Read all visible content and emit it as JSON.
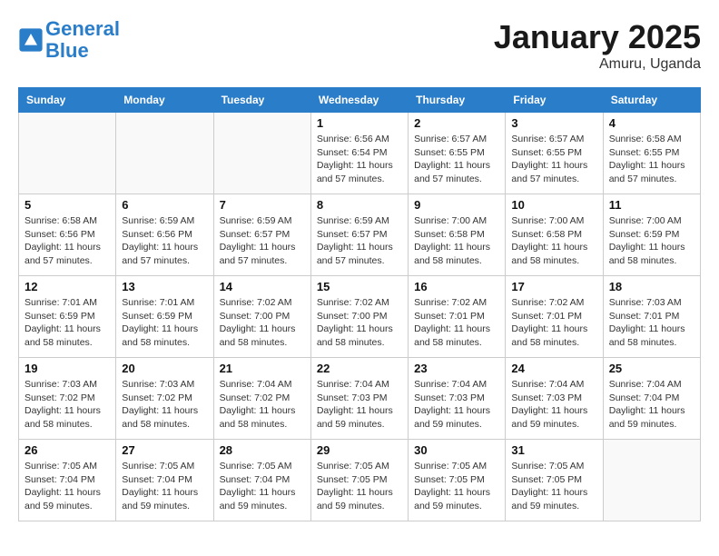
{
  "header": {
    "logo_line1": "General",
    "logo_line2": "Blue",
    "month": "January 2025",
    "location": "Amuru, Uganda"
  },
  "days_of_week": [
    "Sunday",
    "Monday",
    "Tuesday",
    "Wednesday",
    "Thursday",
    "Friday",
    "Saturday"
  ],
  "weeks": [
    [
      {
        "day": "",
        "info": ""
      },
      {
        "day": "",
        "info": ""
      },
      {
        "day": "",
        "info": ""
      },
      {
        "day": "1",
        "info": "Sunrise: 6:56 AM\nSunset: 6:54 PM\nDaylight: 11 hours and 57 minutes."
      },
      {
        "day": "2",
        "info": "Sunrise: 6:57 AM\nSunset: 6:55 PM\nDaylight: 11 hours and 57 minutes."
      },
      {
        "day": "3",
        "info": "Sunrise: 6:57 AM\nSunset: 6:55 PM\nDaylight: 11 hours and 57 minutes."
      },
      {
        "day": "4",
        "info": "Sunrise: 6:58 AM\nSunset: 6:55 PM\nDaylight: 11 hours and 57 minutes."
      }
    ],
    [
      {
        "day": "5",
        "info": "Sunrise: 6:58 AM\nSunset: 6:56 PM\nDaylight: 11 hours and 57 minutes."
      },
      {
        "day": "6",
        "info": "Sunrise: 6:59 AM\nSunset: 6:56 PM\nDaylight: 11 hours and 57 minutes."
      },
      {
        "day": "7",
        "info": "Sunrise: 6:59 AM\nSunset: 6:57 PM\nDaylight: 11 hours and 57 minutes."
      },
      {
        "day": "8",
        "info": "Sunrise: 6:59 AM\nSunset: 6:57 PM\nDaylight: 11 hours and 57 minutes."
      },
      {
        "day": "9",
        "info": "Sunrise: 7:00 AM\nSunset: 6:58 PM\nDaylight: 11 hours and 58 minutes."
      },
      {
        "day": "10",
        "info": "Sunrise: 7:00 AM\nSunset: 6:58 PM\nDaylight: 11 hours and 58 minutes."
      },
      {
        "day": "11",
        "info": "Sunrise: 7:00 AM\nSunset: 6:59 PM\nDaylight: 11 hours and 58 minutes."
      }
    ],
    [
      {
        "day": "12",
        "info": "Sunrise: 7:01 AM\nSunset: 6:59 PM\nDaylight: 11 hours and 58 minutes."
      },
      {
        "day": "13",
        "info": "Sunrise: 7:01 AM\nSunset: 6:59 PM\nDaylight: 11 hours and 58 minutes."
      },
      {
        "day": "14",
        "info": "Sunrise: 7:02 AM\nSunset: 7:00 PM\nDaylight: 11 hours and 58 minutes."
      },
      {
        "day": "15",
        "info": "Sunrise: 7:02 AM\nSunset: 7:00 PM\nDaylight: 11 hours and 58 minutes."
      },
      {
        "day": "16",
        "info": "Sunrise: 7:02 AM\nSunset: 7:01 PM\nDaylight: 11 hours and 58 minutes."
      },
      {
        "day": "17",
        "info": "Sunrise: 7:02 AM\nSunset: 7:01 PM\nDaylight: 11 hours and 58 minutes."
      },
      {
        "day": "18",
        "info": "Sunrise: 7:03 AM\nSunset: 7:01 PM\nDaylight: 11 hours and 58 minutes."
      }
    ],
    [
      {
        "day": "19",
        "info": "Sunrise: 7:03 AM\nSunset: 7:02 PM\nDaylight: 11 hours and 58 minutes."
      },
      {
        "day": "20",
        "info": "Sunrise: 7:03 AM\nSunset: 7:02 PM\nDaylight: 11 hours and 58 minutes."
      },
      {
        "day": "21",
        "info": "Sunrise: 7:04 AM\nSunset: 7:02 PM\nDaylight: 11 hours and 58 minutes."
      },
      {
        "day": "22",
        "info": "Sunrise: 7:04 AM\nSunset: 7:03 PM\nDaylight: 11 hours and 59 minutes."
      },
      {
        "day": "23",
        "info": "Sunrise: 7:04 AM\nSunset: 7:03 PM\nDaylight: 11 hours and 59 minutes."
      },
      {
        "day": "24",
        "info": "Sunrise: 7:04 AM\nSunset: 7:03 PM\nDaylight: 11 hours and 59 minutes."
      },
      {
        "day": "25",
        "info": "Sunrise: 7:04 AM\nSunset: 7:04 PM\nDaylight: 11 hours and 59 minutes."
      }
    ],
    [
      {
        "day": "26",
        "info": "Sunrise: 7:05 AM\nSunset: 7:04 PM\nDaylight: 11 hours and 59 minutes."
      },
      {
        "day": "27",
        "info": "Sunrise: 7:05 AM\nSunset: 7:04 PM\nDaylight: 11 hours and 59 minutes."
      },
      {
        "day": "28",
        "info": "Sunrise: 7:05 AM\nSunset: 7:04 PM\nDaylight: 11 hours and 59 minutes."
      },
      {
        "day": "29",
        "info": "Sunrise: 7:05 AM\nSunset: 7:05 PM\nDaylight: 11 hours and 59 minutes."
      },
      {
        "day": "30",
        "info": "Sunrise: 7:05 AM\nSunset: 7:05 PM\nDaylight: 11 hours and 59 minutes."
      },
      {
        "day": "31",
        "info": "Sunrise: 7:05 AM\nSunset: 7:05 PM\nDaylight: 11 hours and 59 minutes."
      },
      {
        "day": "",
        "info": ""
      }
    ]
  ]
}
